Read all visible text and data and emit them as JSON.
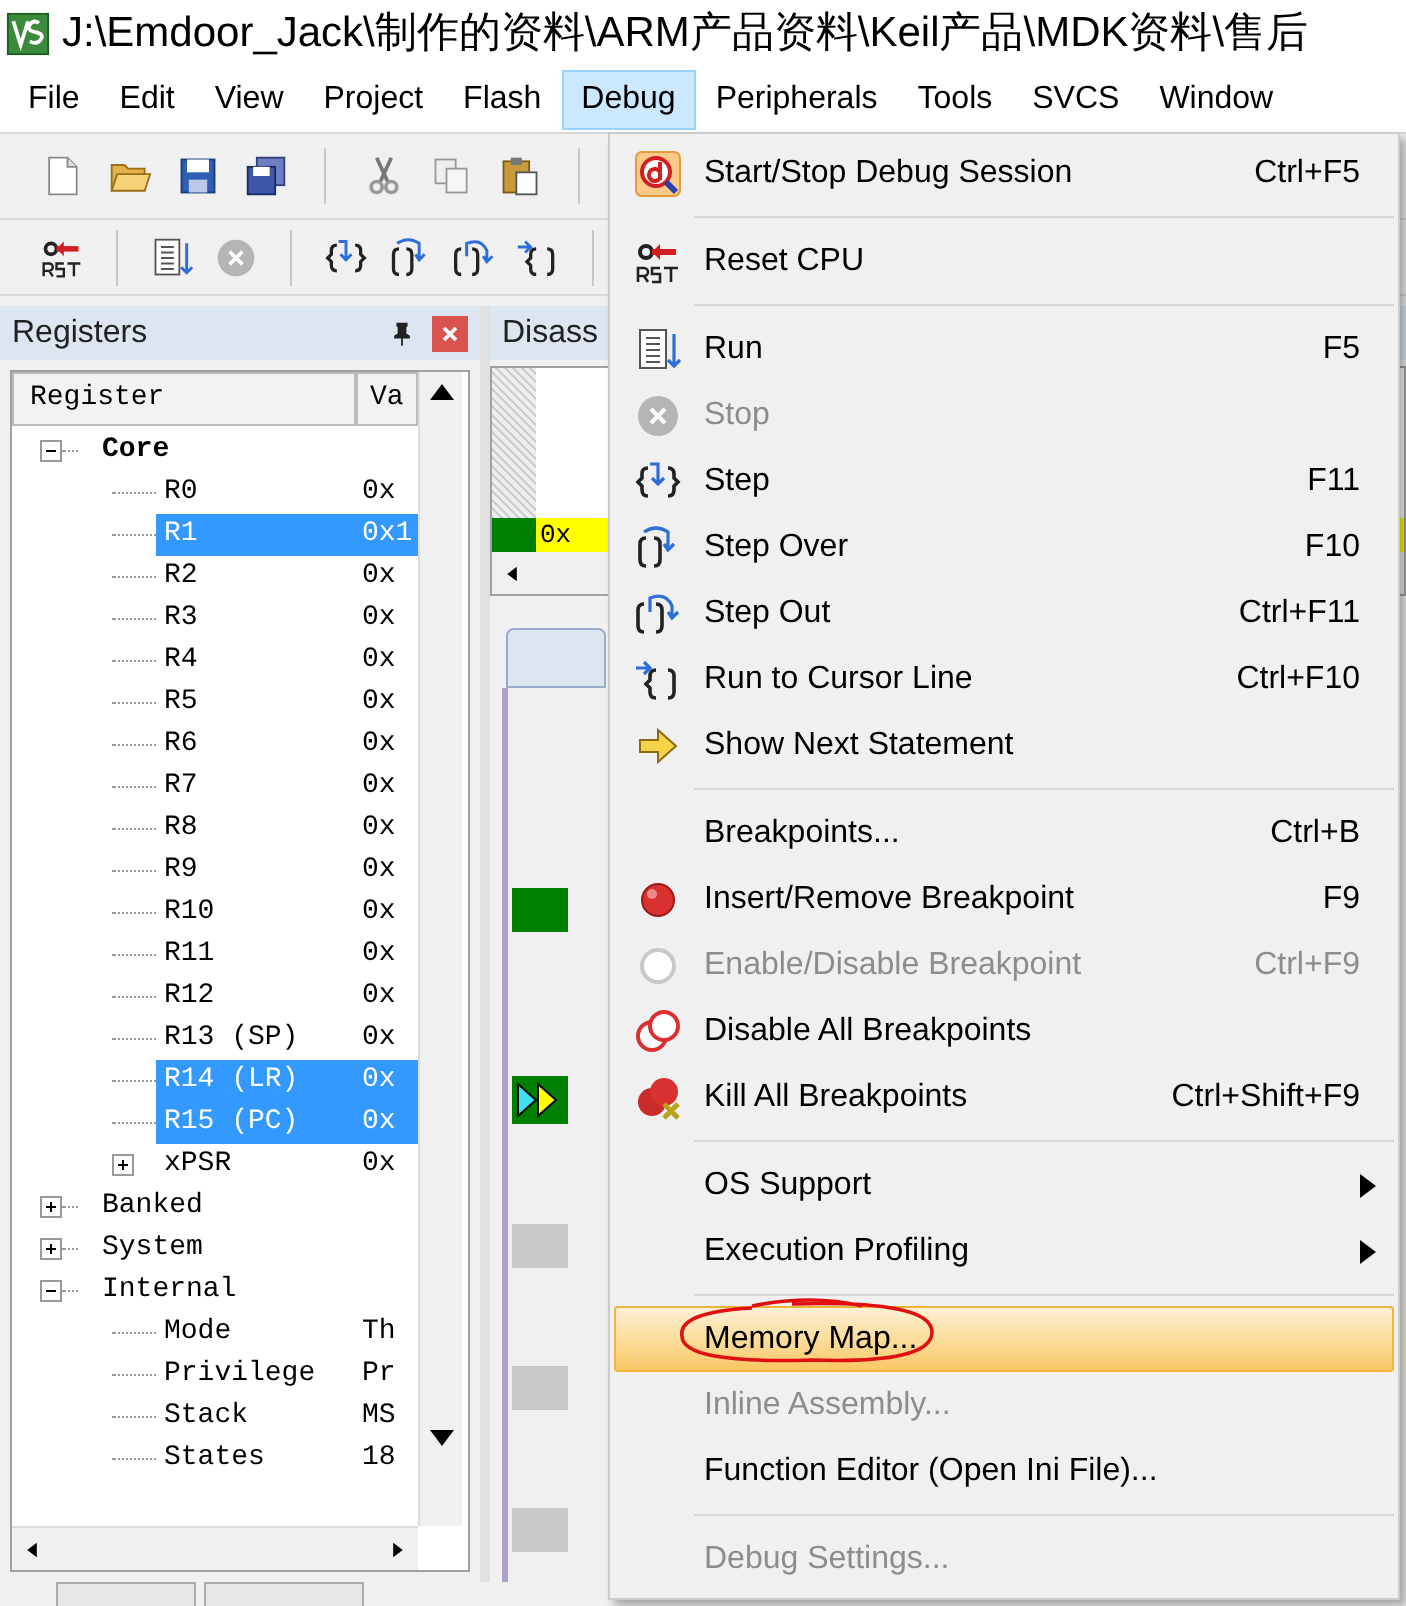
{
  "window": {
    "title": "J:\\Emdoor_Jack\\制作的资料\\ARM产品资料\\Keil产品\\MDK资料\\售后"
  },
  "menubar": [
    {
      "label": "File",
      "selected": false
    },
    {
      "label": "Edit",
      "selected": false
    },
    {
      "label": "View",
      "selected": false
    },
    {
      "label": "Project",
      "selected": false
    },
    {
      "label": "Flash",
      "selected": false
    },
    {
      "label": "Debug",
      "selected": true
    },
    {
      "label": "Peripherals",
      "selected": false
    },
    {
      "label": "Tools",
      "selected": false
    },
    {
      "label": "SVCS",
      "selected": false
    },
    {
      "label": "Window",
      "selected": false
    }
  ],
  "registers_panel": {
    "title": "Registers",
    "columns": [
      "Register",
      "Va"
    ],
    "tree": [
      {
        "name": "Core",
        "bold": true,
        "expanded": true,
        "children": [
          {
            "name": "R0",
            "value": "0x",
            "selected": false
          },
          {
            "name": "R1",
            "value": "0x1",
            "selected": true
          },
          {
            "name": "R2",
            "value": "0x",
            "selected": false
          },
          {
            "name": "R3",
            "value": "0x",
            "selected": false
          },
          {
            "name": "R4",
            "value": "0x",
            "selected": false
          },
          {
            "name": "R5",
            "value": "0x",
            "selected": false
          },
          {
            "name": "R6",
            "value": "0x",
            "selected": false
          },
          {
            "name": "R7",
            "value": "0x",
            "selected": false
          },
          {
            "name": "R8",
            "value": "0x",
            "selected": false
          },
          {
            "name": "R9",
            "value": "0x",
            "selected": false
          },
          {
            "name": "R10",
            "value": "0x",
            "selected": false
          },
          {
            "name": "R11",
            "value": "0x",
            "selected": false
          },
          {
            "name": "R12",
            "value": "0x",
            "selected": false
          },
          {
            "name": "R13 (SP)",
            "value": "0x",
            "selected": false
          },
          {
            "name": "R14 (LR)",
            "value": "0x",
            "selected": true
          },
          {
            "name": "R15 (PC)",
            "value": "0x",
            "selected": true
          },
          {
            "name": "xPSR",
            "value": "0x",
            "selected": false,
            "expanded": false
          }
        ]
      },
      {
        "name": "Banked",
        "bold": false,
        "expanded": false
      },
      {
        "name": "System",
        "bold": false,
        "expanded": false
      },
      {
        "name": "Internal",
        "bold": false,
        "expanded": true,
        "children": [
          {
            "name": "Mode",
            "value": "Th",
            "selected": false
          },
          {
            "name": "Privilege",
            "value": "Pr",
            "selected": false
          },
          {
            "name": "Stack",
            "value": "MS",
            "selected": false
          },
          {
            "name": "States",
            "value": "18",
            "selected": false
          }
        ]
      }
    ]
  },
  "disassembly_panel": {
    "title": "Disass",
    "address": "0x"
  },
  "debug_menu": {
    "items": [
      {
        "kind": "item",
        "label": "Start/Stop Debug Session",
        "shortcut": "Ctrl+F5",
        "disabled": false,
        "selected": false,
        "submenu": false
      },
      {
        "kind": "separator"
      },
      {
        "kind": "item",
        "label": "Reset CPU",
        "disabled": false,
        "selected": false,
        "submenu": false
      },
      {
        "kind": "separator"
      },
      {
        "kind": "item",
        "label": "Run",
        "shortcut": "F5",
        "disabled": false,
        "selected": false,
        "submenu": false
      },
      {
        "kind": "item",
        "label": "Stop",
        "disabled": true,
        "selected": false,
        "submenu": false
      },
      {
        "kind": "item",
        "label": "Step",
        "shortcut": "F11",
        "disabled": false,
        "selected": false,
        "submenu": false
      },
      {
        "kind": "item",
        "label": "Step Over",
        "shortcut": "F10",
        "disabled": false,
        "selected": false,
        "submenu": false
      },
      {
        "kind": "item",
        "label": "Step Out",
        "shortcut": "Ctrl+F11",
        "disabled": false,
        "selected": false,
        "submenu": false
      },
      {
        "kind": "item",
        "label": "Run to Cursor Line",
        "shortcut": "Ctrl+F10",
        "disabled": false,
        "selected": false,
        "submenu": false
      },
      {
        "kind": "item",
        "label": "Show Next Statement",
        "disabled": false,
        "selected": false,
        "submenu": false
      },
      {
        "kind": "separator"
      },
      {
        "kind": "item",
        "label": "Breakpoints...",
        "shortcut": "Ctrl+B",
        "disabled": false,
        "selected": false,
        "submenu": false
      },
      {
        "kind": "item",
        "label": "Insert/Remove Breakpoint",
        "shortcut": "F9",
        "disabled": false,
        "selected": false,
        "submenu": false
      },
      {
        "kind": "item",
        "label": "Enable/Disable Breakpoint",
        "shortcut": "Ctrl+F9",
        "disabled": true,
        "selected": false,
        "submenu": false
      },
      {
        "kind": "item",
        "label": "Disable All Breakpoints",
        "disabled": false,
        "selected": false,
        "submenu": false
      },
      {
        "kind": "item",
        "label": "Kill All Breakpoints",
        "shortcut": "Ctrl+Shift+F9",
        "disabled": false,
        "selected": false,
        "submenu": false
      },
      {
        "kind": "separator"
      },
      {
        "kind": "item",
        "label": "OS Support",
        "disabled": false,
        "selected": false,
        "submenu": true
      },
      {
        "kind": "item",
        "label": "Execution Profiling",
        "disabled": false,
        "selected": false,
        "submenu": true
      },
      {
        "kind": "separator"
      },
      {
        "kind": "item",
        "label": "Memory Map...",
        "disabled": false,
        "selected": true,
        "submenu": false
      },
      {
        "kind": "item",
        "label": "Inline Assembly...",
        "disabled": true,
        "selected": false,
        "submenu": false
      },
      {
        "kind": "item",
        "label": "Function Editor (Open Ini File)...",
        "disabled": false,
        "selected": false,
        "submenu": false
      },
      {
        "kind": "separator"
      },
      {
        "kind": "item",
        "label": "Debug Settings...",
        "disabled": true,
        "selected": false,
        "submenu": false
      }
    ]
  }
}
